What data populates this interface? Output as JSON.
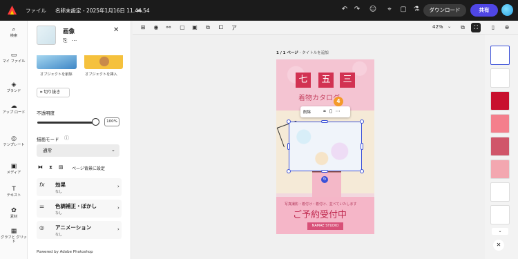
{
  "topbar": {
    "menu": "ファイル",
    "doc_title": "名称未設定 - 2025年1月16日 11.44.54",
    "download": "ダウンロード",
    "share": "共有"
  },
  "leftnav": [
    {
      "label": "検索",
      "icon": "⌕"
    },
    {
      "label": "マイ ファイル",
      "icon": "▭"
    },
    {
      "label": "ブランド",
      "icon": "◈"
    },
    {
      "label": "アップ ロード",
      "icon": "☁"
    },
    {
      "label": "テンプレート",
      "icon": "◎"
    },
    {
      "label": "メディア",
      "icon": "▣"
    },
    {
      "label": "テキスト",
      "icon": "T"
    },
    {
      "label": "素材",
      "icon": "✿"
    },
    {
      "label": "グラフと グリッド",
      "icon": "▦"
    }
  ],
  "panel": {
    "title": "画像",
    "actions": [
      "オブジェクトを削除",
      "オブジェクトを挿入"
    ],
    "crop": "切り抜き",
    "opacity_label": "不透明度",
    "opacity_value": "100%",
    "opacity": 1.0,
    "blend_label": "描画モード",
    "blend_value": "通常",
    "bg_set": "ページ背景に設定",
    "sections": [
      {
        "title": "効果",
        "sub": "なし",
        "icon": "fx"
      },
      {
        "title": "色調補正・ぼかし",
        "sub": "なし",
        "icon": "⚌"
      },
      {
        "title": "アニメーション",
        "sub": "なし",
        "icon": "◎"
      }
    ],
    "powered": "Powered by Adobe Photoshop"
  },
  "canvas": {
    "zoom": "42%",
    "page_header_num": "1 / 1 ページ",
    "page_header_title": "- タイトルを追加"
  },
  "poster": {
    "kanji": [
      "七",
      "五",
      "三"
    ],
    "subtitle": "着物カタログ",
    "line1": "写真撮影・着付け・着付け、並べていたします",
    "line2": "ご予約受付中",
    "brand": "NAMAE STUDIO"
  },
  "floatbar": {
    "delete": "削除"
  },
  "badge": "4",
  "rail": {
    "thumb_colors": [
      "#ffffff",
      "#ffffff",
      "#c8102e",
      "#f47f8c",
      "#d0566a",
      "#f3a7b0",
      "#ffffff",
      "#ffffff"
    ]
  }
}
